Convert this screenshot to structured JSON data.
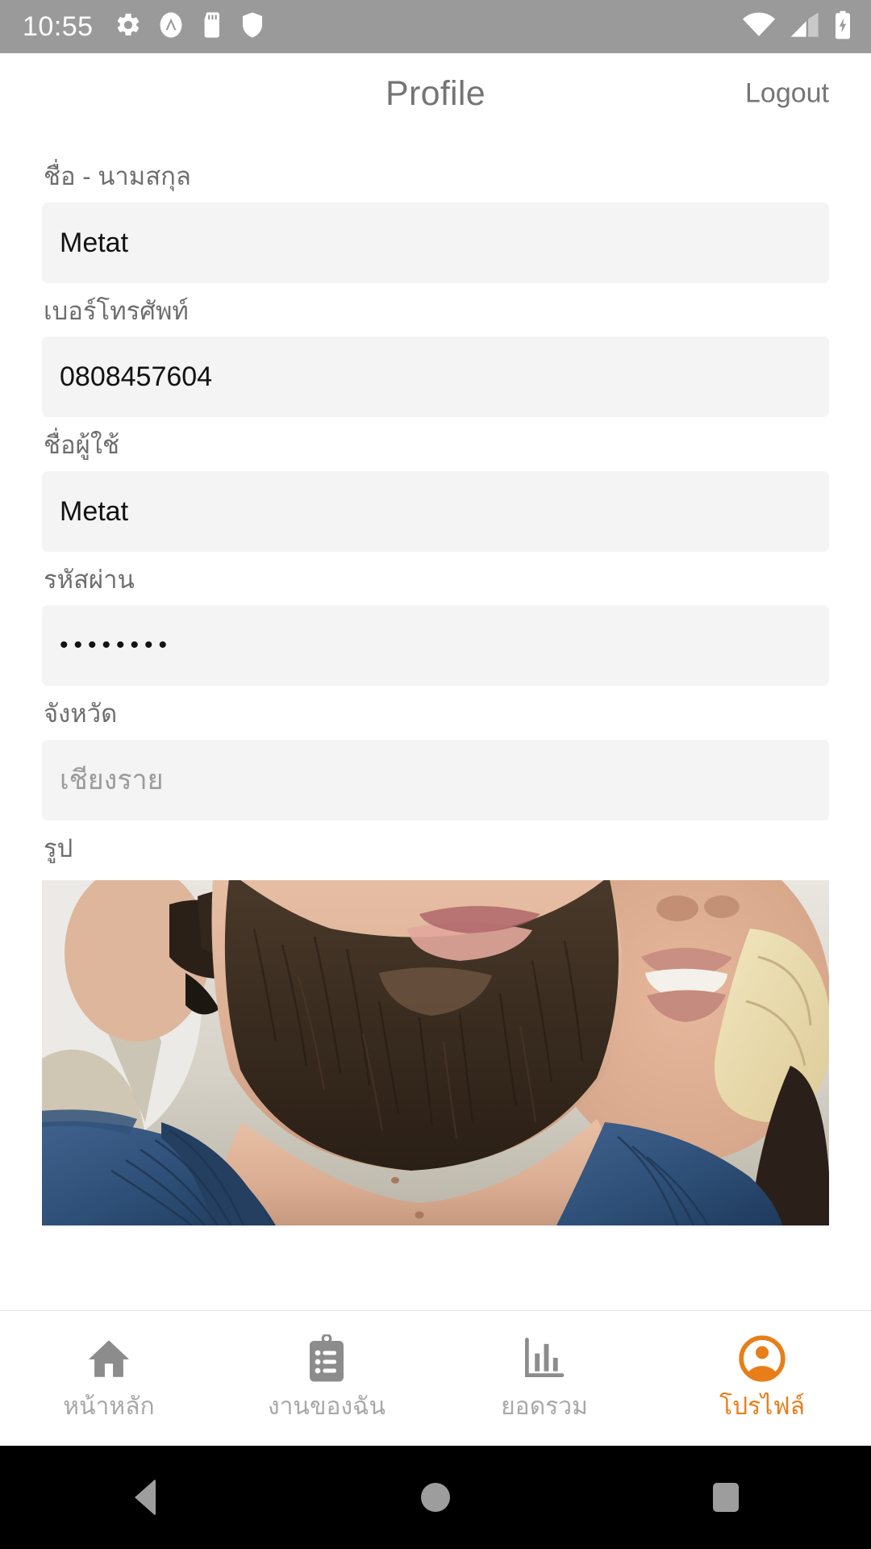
{
  "status_bar": {
    "time": "10:55",
    "left_icons": [
      "gear-icon",
      "adaway-icon",
      "sdcard-icon",
      "shield-icon"
    ],
    "right_icons": [
      "wifi-icon",
      "cell-signal-icon",
      "battery-charging-icon"
    ],
    "background_color": "#9a9a9a",
    "icon_color": "#ffffff"
  },
  "header": {
    "title": "Profile",
    "logout_label": "Logout",
    "text_color": "#757575"
  },
  "form": {
    "fields": [
      {
        "label": "ชื่อ - นามสกุล",
        "value": "Metat",
        "name": "fullname",
        "is_placeholder": false,
        "masked": false
      },
      {
        "label": "เบอร์โทรศัพท์",
        "value": "0808457604",
        "name": "phone",
        "is_placeholder": false,
        "masked": false
      },
      {
        "label": "ชื่อผู้ใช้",
        "value": "Metat",
        "name": "username",
        "is_placeholder": false,
        "masked": false
      },
      {
        "label": "รหัสผ่าน",
        "value": "••••••••",
        "name": "password",
        "is_placeholder": false,
        "masked": true
      },
      {
        "label": "จังหวัด",
        "value": "เชียงราย",
        "name": "province",
        "is_placeholder": true,
        "masked": false
      }
    ],
    "photo_label": "รูป",
    "field_background": "#f3f4f3",
    "label_color": "#6e6e6e",
    "value_color": "#121212",
    "placeholder_color": "#9b9b9b"
  },
  "tab_bar": {
    "active_color": "#e87e19",
    "inactive_color": "#8c8c8c",
    "label_color": "#a8a8a8",
    "items": [
      {
        "label": "หน้าหลัก",
        "icon": "home-icon",
        "active": false
      },
      {
        "label": "งานของฉัน",
        "icon": "clipboard-list-icon",
        "active": false
      },
      {
        "label": "ยอดรวม",
        "icon": "bar-chart-icon",
        "active": false
      },
      {
        "label": "โปรไฟล์",
        "icon": "account-circle-icon",
        "active": true
      }
    ]
  },
  "android_nav": {
    "buttons": [
      "back-button",
      "home-button",
      "recents-button"
    ],
    "background_color": "#000000",
    "icon_color": "#9d9d9d"
  }
}
